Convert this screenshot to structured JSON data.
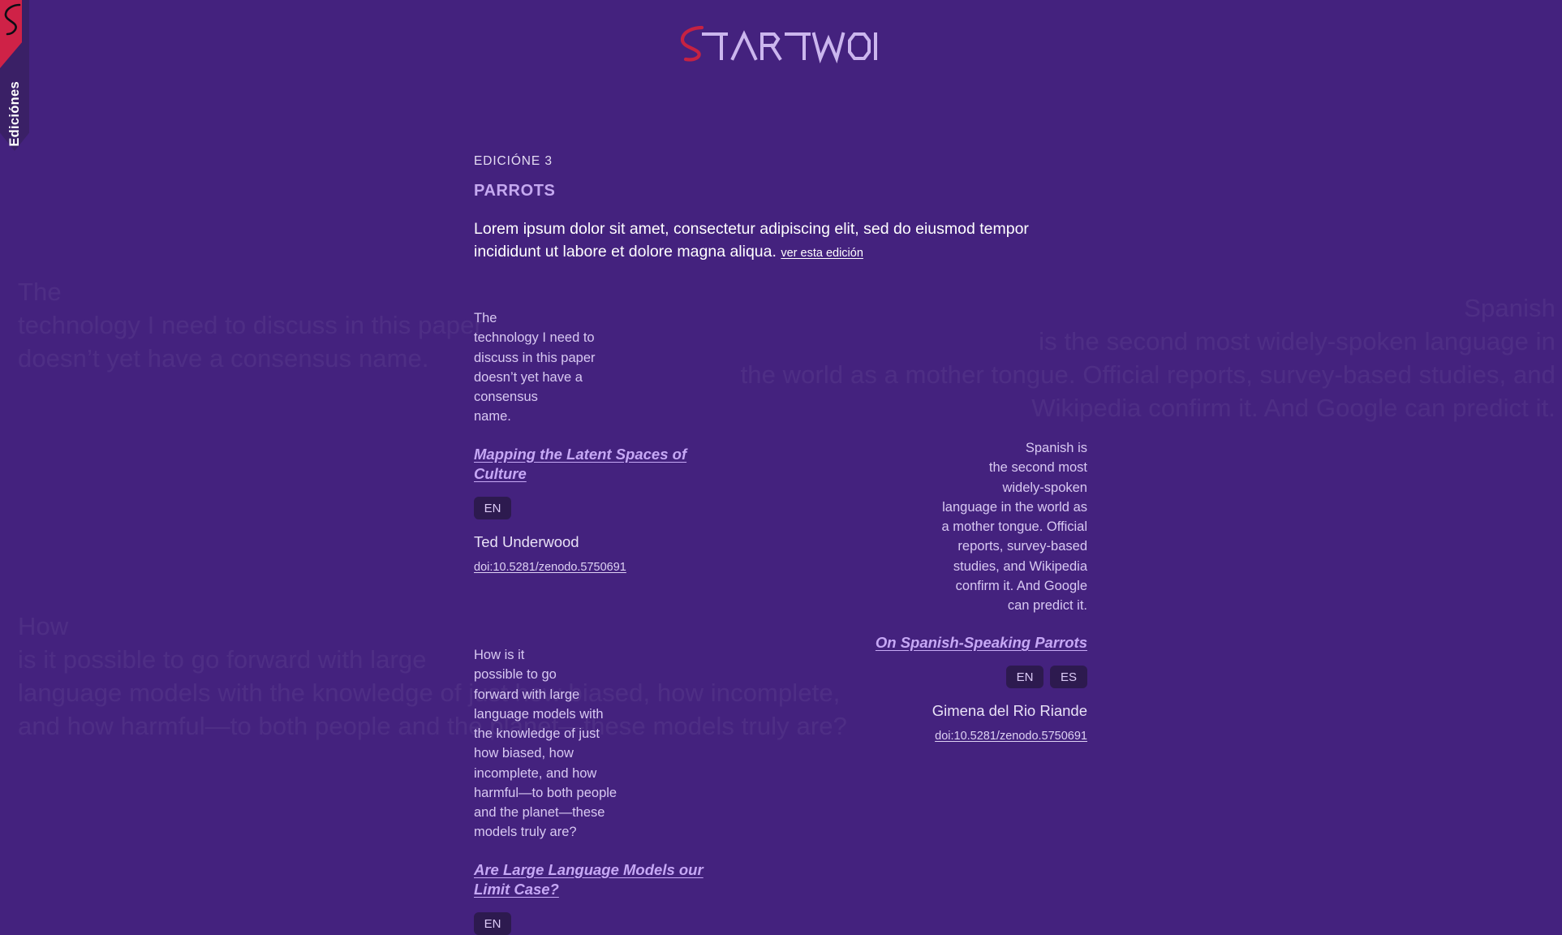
{
  "colors": {
    "page_background": "#44227E",
    "ribbon_dark": "#3A2066",
    "flag_red": "#CF2247",
    "logo_accent": "#C62242",
    "logo_text": "#CBB6EE",
    "accent_lavender": "#C6A8F5",
    "badge_background": "#2D1A4F"
  },
  "sidebar": {
    "label": "Ediciónes",
    "logo_mark": "s-swoosh-icon"
  },
  "header": {
    "logo_accent_letter": "S",
    "logo_text": "TARTWORDS",
    "logo_full": "STARTWORDS"
  },
  "edition": {
    "kicker": "EDICIÓNE 3",
    "title": "PARROTS",
    "description": "Lorem ipsum dolor sit amet, consectetur adipiscing elit, sed do eiusmod tempor incididunt ut labore et dolore magna aliqua.",
    "link_label": "ver esta edición"
  },
  "ghost_quotes": [
    "The\ntechnology I need to discuss in this paper\ndoesn’t yet have a consensus name.",
    "Spanish\nis the second most widely-spoken language in\nthe world as a mother tongue. Official reports, survey-based studies, and\nWikipedia confirm it. And Google can predict it.",
    "How\nis it possible to go forward with large\nlanguage models with the knowledge of just how biased, how incomplete,\nand how harmful—to both people and the planet—these models truly are?"
  ],
  "articles": [
    {
      "side": "left",
      "quote": "The\ntechnology I need to\ndiscuss in this paper\ndoesn’t yet have a\nconsensus\nname.",
      "title": "Mapping the Latent Spaces of Culture",
      "languages": [
        "EN"
      ],
      "author": "Ted Underwood",
      "doi": "doi:10.5281/zenodo.5750691"
    },
    {
      "side": "right",
      "quote": "Spanish is\nthe second most\nwidely-spoken\nlanguage in the world as\na mother tongue. Official\nreports, survey-based\nstudies, and Wikipedia\nconfirm it. And Google\ncan predict it.",
      "title": "On Spanish-Speaking Parrots",
      "languages": [
        "EN",
        "ES"
      ],
      "author": "Gimena del Rio Riande",
      "doi": "doi:10.5281/zenodo.5750691"
    },
    {
      "side": "left",
      "quote": "How is it\npossible to go\nforward with large\nlanguage models with\nthe knowledge of just\nhow biased, how\nincomplete, and how\nharmful—to both people\nand the planet—these\nmodels truly are?",
      "title": "Are Large Language Models our Limit Case?",
      "languages": [
        "EN"
      ],
      "author": "",
      "doi": ""
    }
  ]
}
